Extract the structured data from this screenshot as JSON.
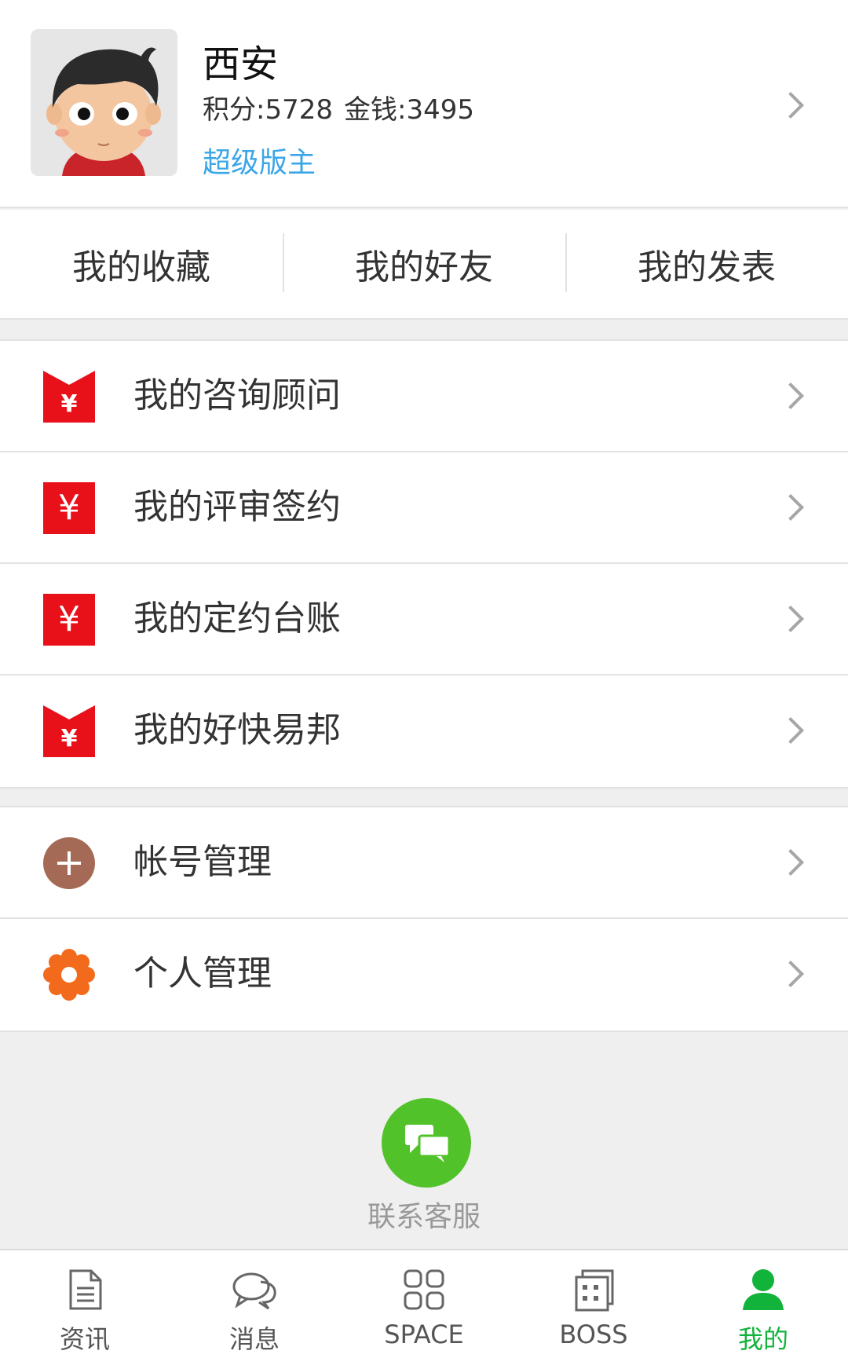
{
  "profile": {
    "name": "西安",
    "points_text": "积分:5728",
    "money_text": "金钱:3495",
    "role": "超级版主"
  },
  "quick_links": [
    {
      "label": "我的收藏"
    },
    {
      "label": "我的好友"
    },
    {
      "label": "我的发表"
    }
  ],
  "menu_group1": [
    {
      "label": "我的咨询顾问",
      "icon": "red-envelope-icon"
    },
    {
      "label": "我的评审签约",
      "icon": "yen-square-icon"
    },
    {
      "label": "我的定约台账",
      "icon": "yen-square-icon"
    },
    {
      "label": "我的好快易邦",
      "icon": "red-envelope-icon"
    }
  ],
  "menu_group2": [
    {
      "label": "帐号管理",
      "icon": "plus-circle-icon"
    },
    {
      "label": "个人管理",
      "icon": "gear-icon"
    }
  ],
  "service": {
    "label": "联系客服"
  },
  "tabbar": {
    "tabs": [
      {
        "label": "资讯",
        "icon": "document-icon"
      },
      {
        "label": "消息",
        "icon": "chat-icon"
      },
      {
        "label": "SPACE",
        "icon": "grid-icon"
      },
      {
        "label": "BOSS",
        "icon": "building-icon"
      },
      {
        "label": "我的",
        "icon": "user-icon"
      }
    ],
    "active_index": 4
  },
  "colors": {
    "accent_green": "#12b33a",
    "service_green": "#52c22b",
    "role_blue": "#3aa6e8",
    "icon_red": "#e8111a",
    "icon_brown": "#a56a55",
    "icon_orange": "#f26a1b"
  }
}
